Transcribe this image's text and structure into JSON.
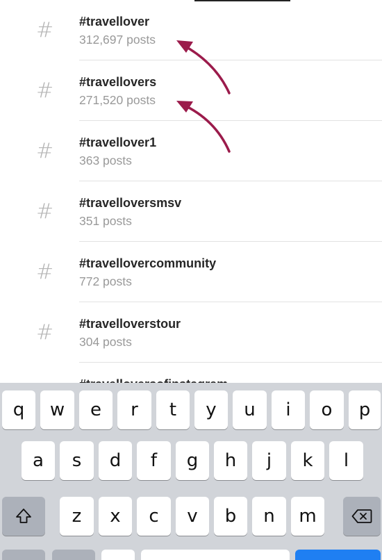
{
  "results": [
    {
      "tag": "#travellover",
      "count": "312,697 posts"
    },
    {
      "tag": "#travellovers",
      "count": "271,520 posts"
    },
    {
      "tag": "#travellover1",
      "count": "363 posts"
    },
    {
      "tag": "#travelloversmsv",
      "count": "351 posts"
    },
    {
      "tag": "#travellovercommunity",
      "count": "772 posts"
    },
    {
      "tag": "#travelloverstour",
      "count": "304 posts"
    },
    {
      "tag": "#travelloversofinstagram",
      "count": ""
    }
  ],
  "hash_symbol": "#",
  "arrow_color": "#9b1b4b",
  "keyboard": {
    "row1": [
      "q",
      "w",
      "e",
      "r",
      "t",
      "y",
      "u",
      "i",
      "o",
      "p"
    ],
    "row2": [
      "a",
      "s",
      "d",
      "f",
      "g",
      "h",
      "j",
      "k",
      "l"
    ],
    "row3": [
      "z",
      "x",
      "c",
      "v",
      "b",
      "n",
      "m"
    ],
    "shift_icon": "shift-arrow-icon",
    "delete_icon": "backspace-icon",
    "accent_color": "#1f7ff2"
  }
}
